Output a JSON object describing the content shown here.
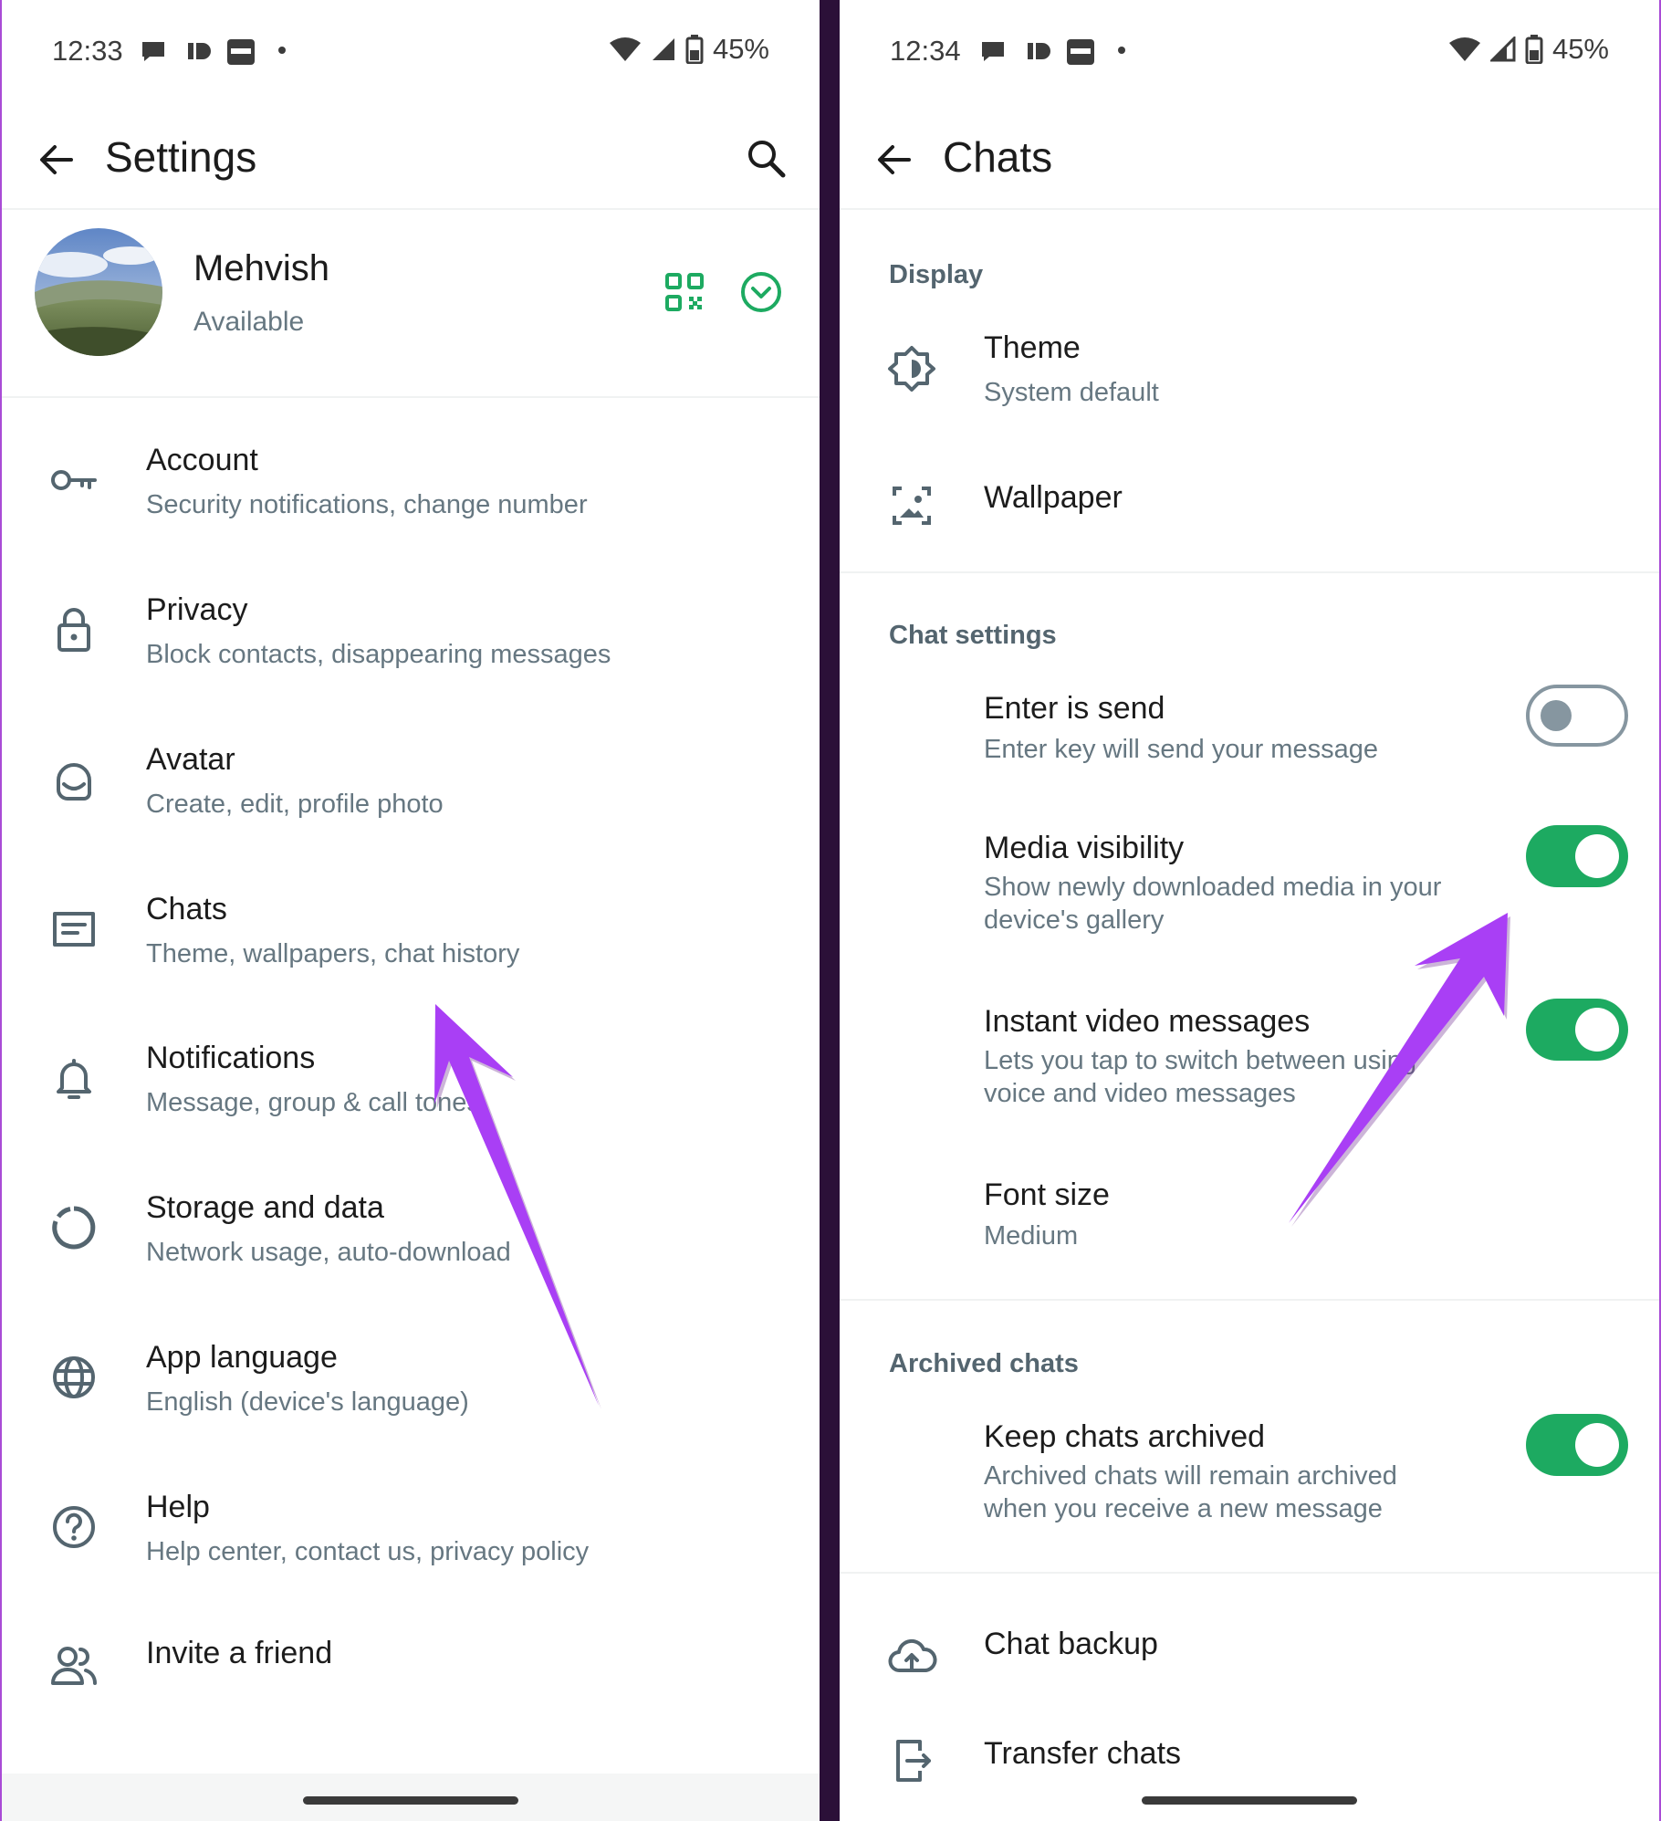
{
  "left_screen": {
    "status": {
      "time": "12:33",
      "battery": "45%"
    },
    "title": "Settings",
    "profile": {
      "name": "Mehvish",
      "status": "Available"
    },
    "items": [
      {
        "title": "Account",
        "subtitle": "Security notifications, change number",
        "icon": "key-icon"
      },
      {
        "title": "Privacy",
        "subtitle": "Block contacts, disappearing messages",
        "icon": "lock-icon"
      },
      {
        "title": "Avatar",
        "subtitle": "Create, edit, profile photo",
        "icon": "avatar-face-icon"
      },
      {
        "title": "Chats",
        "subtitle": "Theme, wallpapers, chat history",
        "icon": "chat-icon"
      },
      {
        "title": "Notifications",
        "subtitle": "Message, group & call tones",
        "icon": "bell-icon"
      },
      {
        "title": "Storage and data",
        "subtitle": "Network usage, auto-download",
        "icon": "storage-circle-icon"
      },
      {
        "title": "App language",
        "subtitle": "English (device's language)",
        "icon": "globe-icon"
      },
      {
        "title": "Help",
        "subtitle": "Help center, contact us, privacy policy",
        "icon": "help-icon"
      },
      {
        "title": "Invite a friend",
        "subtitle": "",
        "icon": "people-icon"
      }
    ]
  },
  "right_screen": {
    "status": {
      "time": "12:34",
      "battery": "45%"
    },
    "title": "Chats",
    "display": {
      "heading": "Display",
      "theme": {
        "title": "Theme",
        "subtitle": "System default"
      },
      "wallpaper": {
        "title": "Wallpaper"
      }
    },
    "chat_settings": {
      "heading": "Chat settings",
      "enter_is_send": {
        "title": "Enter is send",
        "subtitle": "Enter key will send your message",
        "enabled": false
      },
      "media_visibility": {
        "title": "Media visibility",
        "subtitle": "Show newly downloaded media in your device's gallery",
        "enabled": true
      },
      "instant_video": {
        "title": "Instant video messages",
        "subtitle": "Lets you tap to switch between using voice and video messages",
        "enabled": true
      },
      "font_size": {
        "title": "Font size",
        "subtitle": "Medium"
      }
    },
    "archived": {
      "heading": "Archived chats",
      "keep_archived": {
        "title": "Keep chats archived",
        "subtitle": "Archived chats will remain archived when you receive a new message",
        "enabled": true
      }
    },
    "chat_backup": {
      "title": "Chat backup"
    },
    "transfer_chats": {
      "title": "Transfer chats"
    }
  },
  "colors": {
    "accent": "#1daa61",
    "annotation_arrow": "#a93ff5"
  }
}
